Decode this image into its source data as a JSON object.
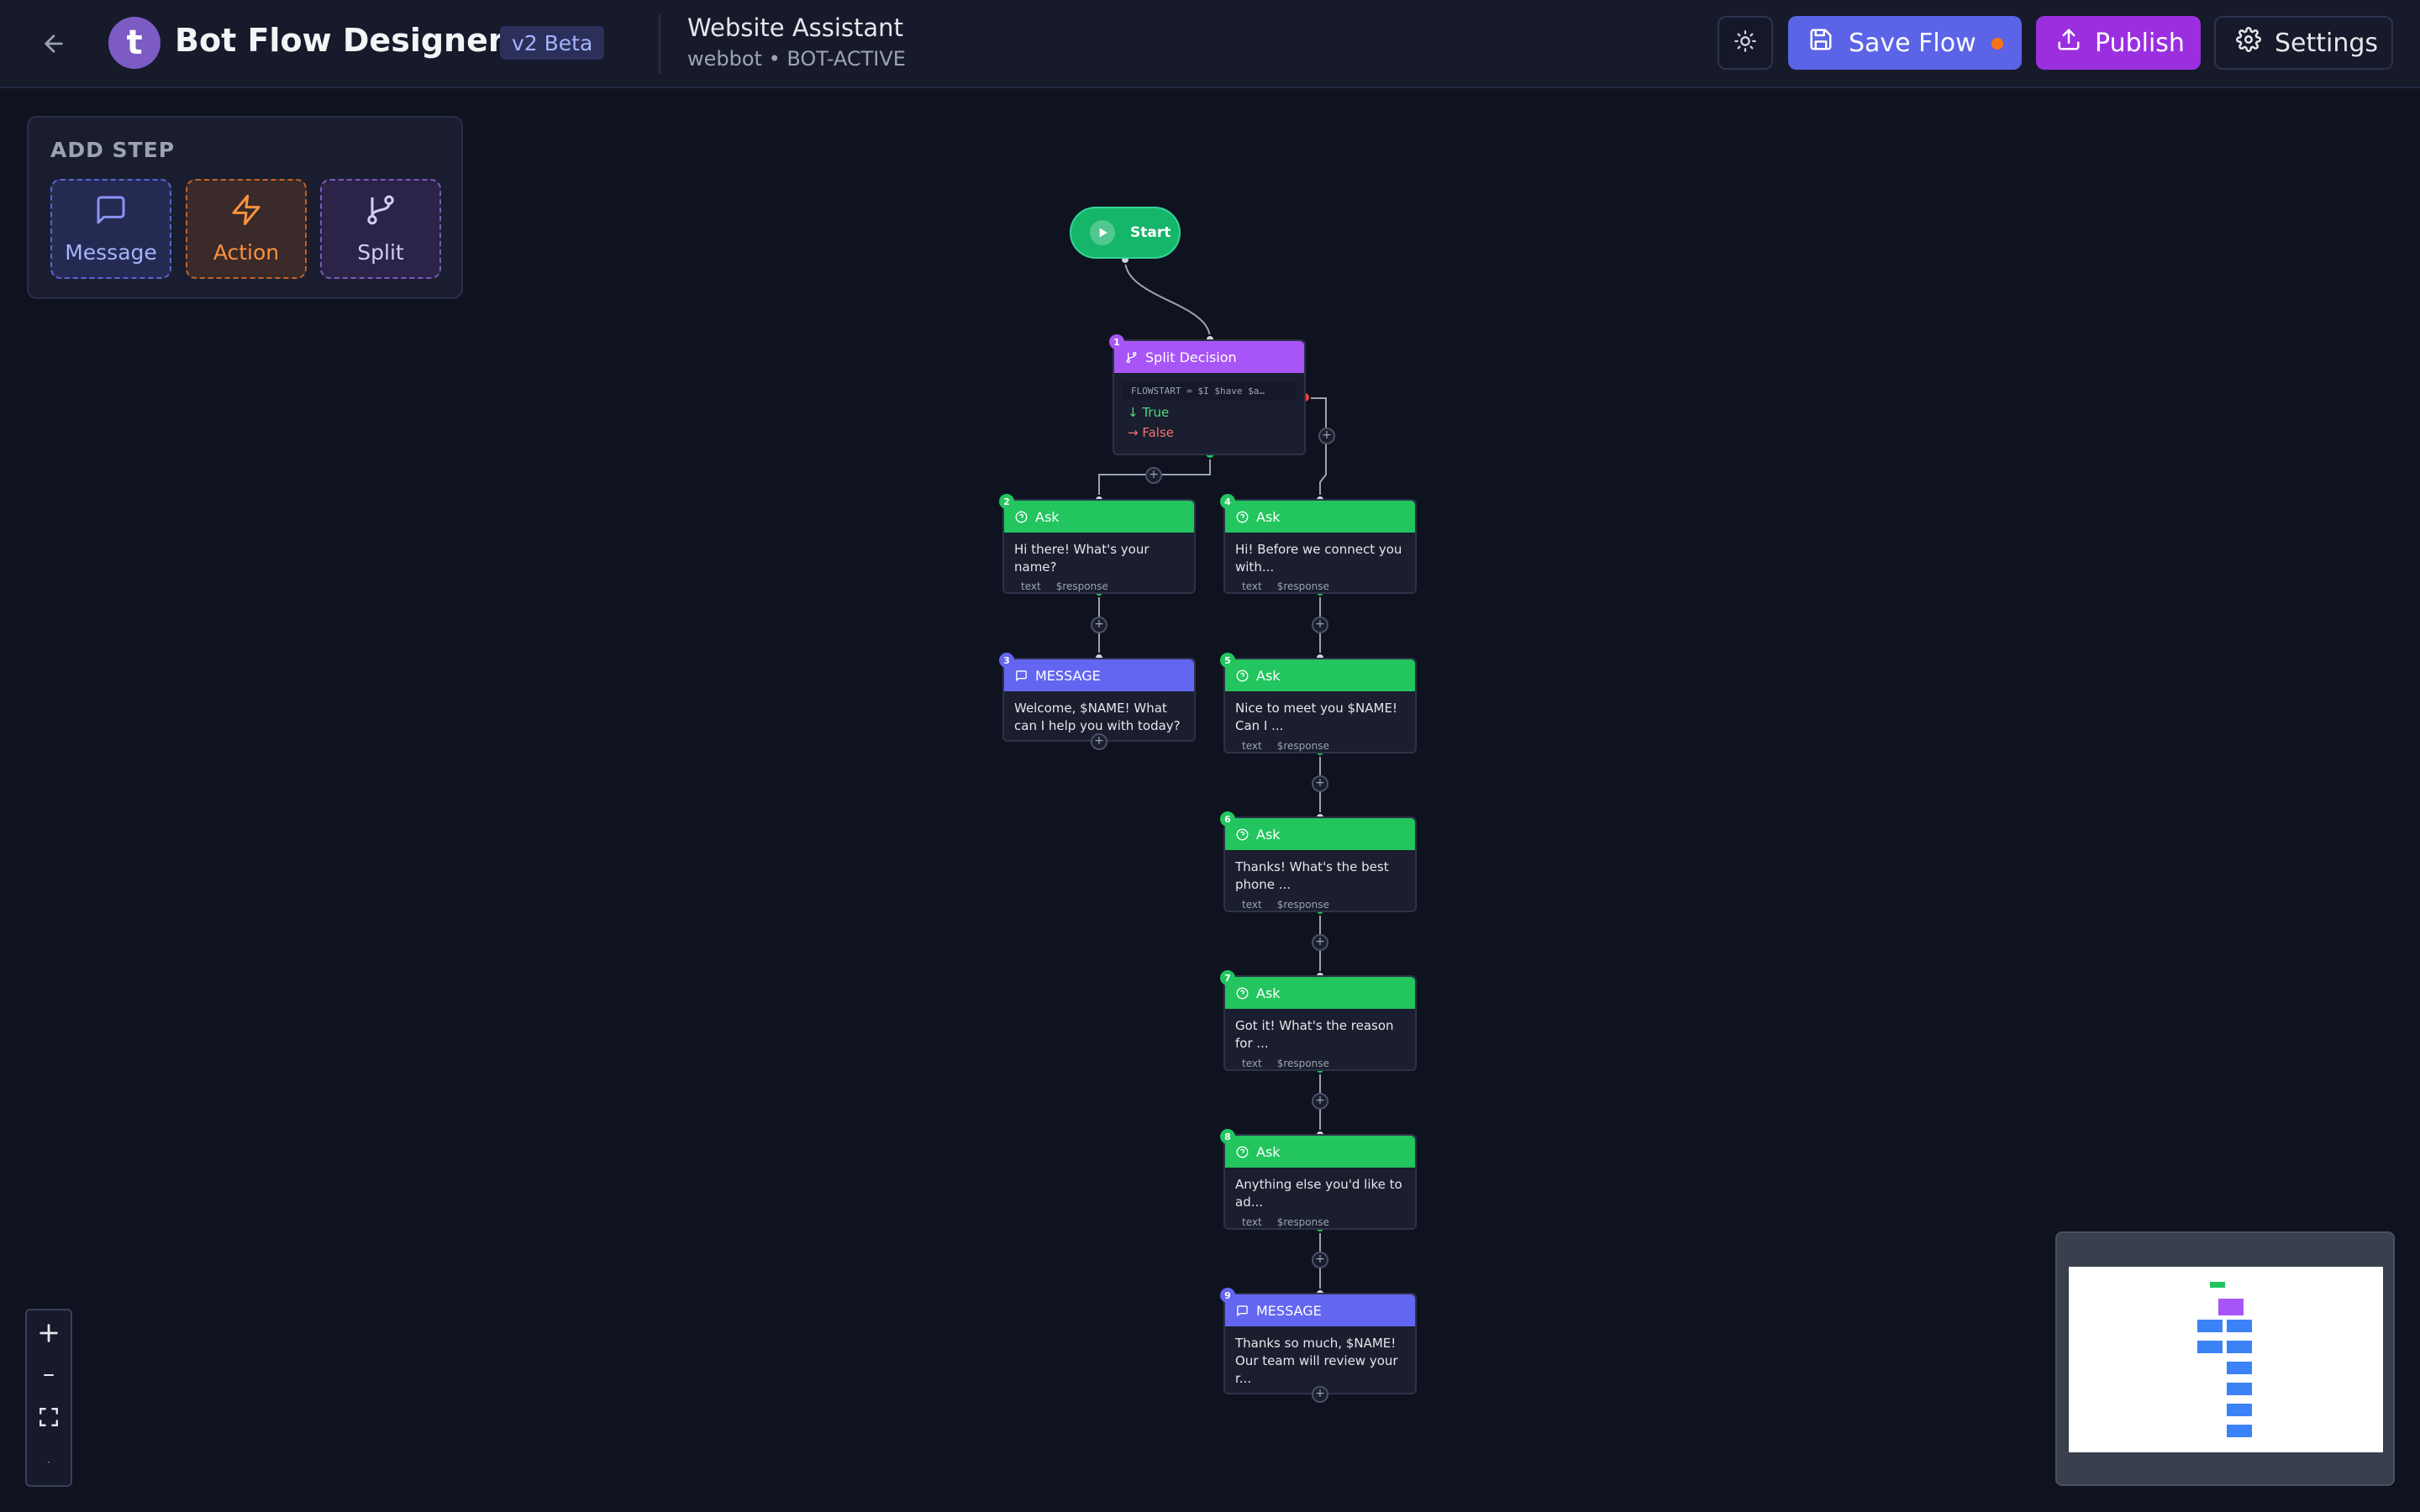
{
  "header": {
    "logo_letter": "t",
    "app_title": "Bot Flow Designer",
    "version_badge": "v2 Beta",
    "bot_name": "Website Assistant",
    "bot_meta": "webbot • BOT-ACTIVE",
    "save_label": "Save Flow",
    "publish_label": "Publish",
    "settings_label": "Settings",
    "unsaved_color": "#f97316"
  },
  "add_step": {
    "title": "ADD STEP",
    "message_label": "Message",
    "action_label": "Action",
    "split_label": "Split"
  },
  "start": {
    "label": "Start"
  },
  "split": {
    "number": "1",
    "title": "Split Decision",
    "condition": "FLOWSTART = $I $have $a…",
    "true_label": "True",
    "false_label": "False"
  },
  "nodes": [
    {
      "number": "2",
      "type": "Ask",
      "text": "Hi there! What's your name?",
      "foot_type": "text",
      "foot_var": "$response"
    },
    {
      "number": "3",
      "type": "MESSAGE",
      "text": "Welcome, $NAME! What can I help you with today?"
    },
    {
      "number": "4",
      "type": "Ask",
      "text": "Hi! Before we connect you with...",
      "foot_type": "text",
      "foot_var": "$response"
    },
    {
      "number": "5",
      "type": "Ask",
      "text": "Nice to meet you $NAME! Can I ...",
      "foot_type": "text",
      "foot_var": "$response"
    },
    {
      "number": "6",
      "type": "Ask",
      "text": "Thanks! What's the best phone ...",
      "foot_type": "text",
      "foot_var": "$response"
    },
    {
      "number": "7",
      "type": "Ask",
      "text": "Got it! What's the reason for ...",
      "foot_type": "text",
      "foot_var": "$response"
    },
    {
      "number": "8",
      "type": "Ask",
      "text": "Anything else you'd like to ad...",
      "foot_type": "text",
      "foot_var": "$response"
    },
    {
      "number": "9",
      "type": "MESSAGE",
      "text": "Thanks so much, $NAME! Our team will review your r..."
    }
  ],
  "zoom_controls": {
    "zoom_in": "+",
    "zoom_out": "−",
    "fit": "fit",
    "lock": "·"
  },
  "colors": {
    "ask": "#22c55e",
    "message": "#6366f1",
    "split": "#a855f7",
    "start": "#16b66a",
    "true": "#4ade80",
    "false": "#f87171"
  }
}
